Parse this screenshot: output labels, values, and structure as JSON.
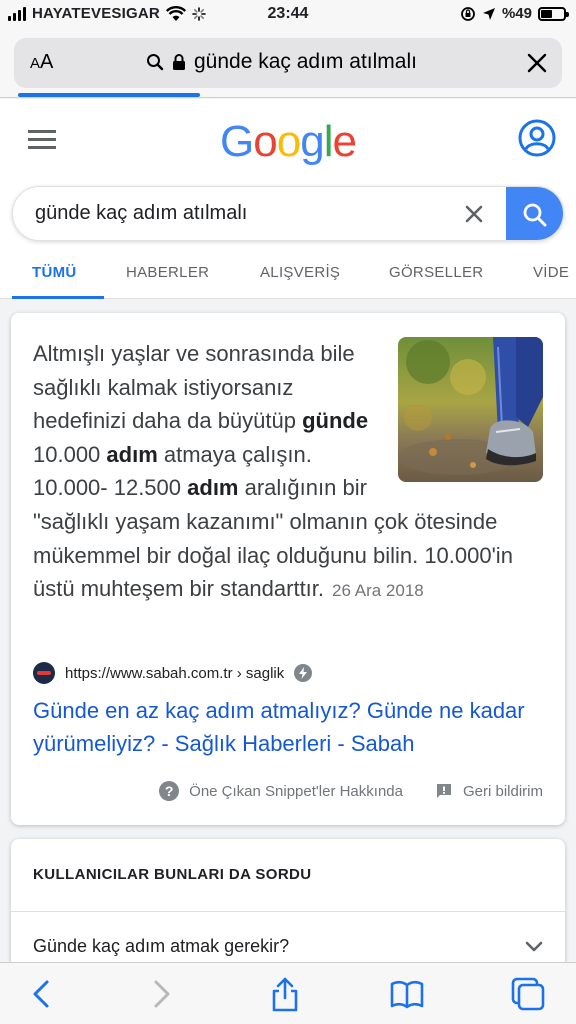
{
  "status_bar": {
    "carrier": "HAYATEVESIGAR",
    "time": "23:44",
    "battery": "%49"
  },
  "address_bar": {
    "text_size_label_small": "A",
    "text_size_label_large": "A",
    "url_text": "günde kaç adım atılmalı"
  },
  "google": {
    "logo_letters": [
      {
        "char": "G",
        "color": "#4285f4"
      },
      {
        "char": "o",
        "color": "#ea4335"
      },
      {
        "char": "o",
        "color": "#fbbc05"
      },
      {
        "char": "g",
        "color": "#4285f4"
      },
      {
        "char": "l",
        "color": "#34a853"
      },
      {
        "char": "e",
        "color": "#ea4335"
      }
    ],
    "search_query": "günde kaç adım atılmalı",
    "tabs": [
      "TÜMÜ",
      "HABERLER",
      "ALIŞVERİŞ",
      "GÖRSELLER",
      "VİDE"
    ],
    "active_tab": "TÜMÜ"
  },
  "snippet": {
    "t1": "Altmışlı yaşlar ve sonrasında bile sağlıklı kalmak istiyorsanız hedefinizi daha da büyütüp ",
    "b1": "günde",
    "t2": " 10.000 ",
    "b2": "adım",
    "t3": " atmaya çalışın. 10.000- 12.500 ",
    "b3": "adım",
    "t4": " aralığının bir \"sağlıklı yaşam kazanımı\" olmanın çok ötesinde mükemmel bir doğal ilaç olduğunu bilin. 10.000'in üstü muhteşem bir standarttır.",
    "date": "26 Ara 2018",
    "source_url": "https://www.sabah.com.tr › saglik",
    "result_title": "Günde en az kaç adım atmalıyız? Günde ne kadar yürümeliyiz? - Sağlık Haberleri - Sabah",
    "about_label": "Öne Çıkan Snippet'ler Hakkında",
    "feedback_label": "Geri bildirim"
  },
  "paa": {
    "title": "KULLANICILAR BUNLARI DA SORDU",
    "questions": [
      "Günde kaç adım atmak gerekir?"
    ]
  },
  "colors": {
    "google_blue": "#4285f4",
    "link_blue": "#1558d6",
    "tab_active": "#1a73e8"
  }
}
